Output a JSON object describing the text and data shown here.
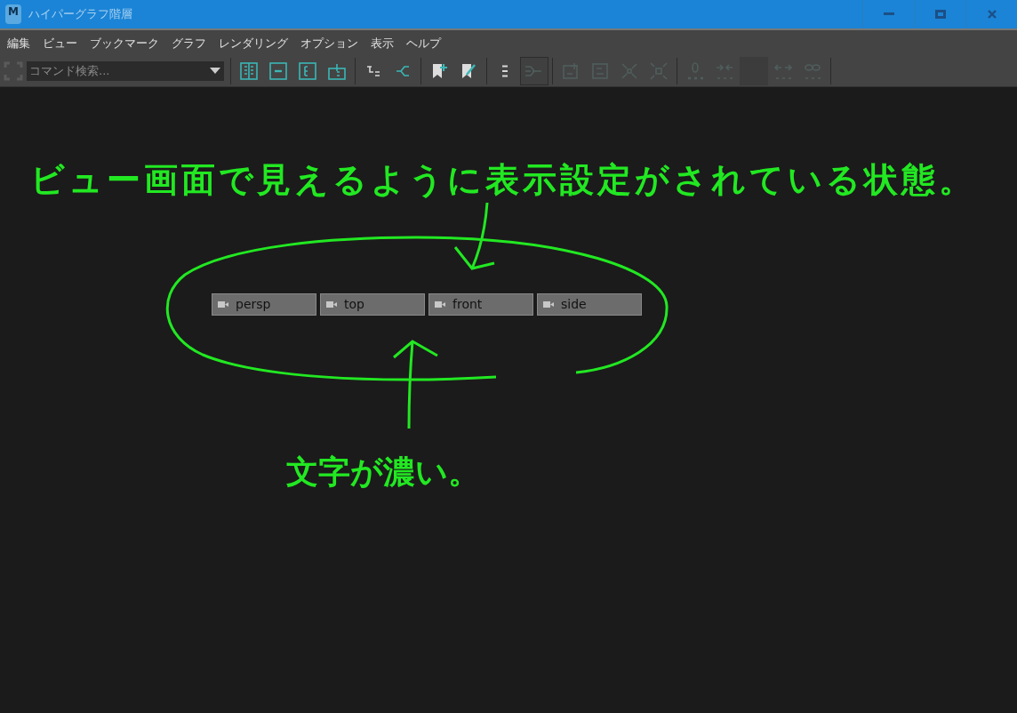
{
  "window": {
    "logo": "M",
    "title": "ハイパーグラフ階層"
  },
  "menu": [
    "編集",
    "ビュー",
    "ブックマーク",
    "グラフ",
    "レンダリング",
    "オプション",
    "表示",
    "ヘルプ"
  ],
  "command_search": {
    "placeholder": "コマンド検索..."
  },
  "toolbar": [
    {
      "kind": "layout",
      "disabled": false,
      "selected": false
    },
    {
      "kind": "minus",
      "disabled": false,
      "selected": false
    },
    {
      "kind": "column",
      "disabled": false,
      "selected": false
    },
    {
      "kind": "split",
      "disabled": false,
      "selected": false
    },
    {
      "kind": "separator"
    },
    {
      "kind": "tree",
      "disabled": false,
      "selected": false
    },
    {
      "kind": "branch",
      "disabled": false,
      "selected": false
    },
    {
      "kind": "separator"
    },
    {
      "kind": "bookmark-add",
      "disabled": false,
      "selected": false
    },
    {
      "kind": "bookmark-edit",
      "disabled": false,
      "selected": false
    },
    {
      "kind": "separator"
    },
    {
      "kind": "list",
      "disabled": false,
      "selected": false
    },
    {
      "kind": "flow",
      "disabled": true,
      "selected": true
    },
    {
      "kind": "separator"
    },
    {
      "kind": "frame-add",
      "disabled": true,
      "selected": false
    },
    {
      "kind": "frame",
      "disabled": true,
      "selected": false
    },
    {
      "kind": "expand",
      "disabled": true,
      "selected": false
    },
    {
      "kind": "collapse",
      "disabled": true,
      "selected": false
    },
    {
      "kind": "separator"
    },
    {
      "kind": "zero",
      "disabled": true,
      "selected": false
    },
    {
      "kind": "merge",
      "disabled": true,
      "selected": false
    },
    {
      "kind": "blank",
      "disabled": true,
      "selected": false
    },
    {
      "kind": "spread",
      "disabled": true,
      "selected": false
    },
    {
      "kind": "link",
      "disabled": true,
      "selected": false
    },
    {
      "kind": "separator"
    }
  ],
  "nodes": [
    {
      "label": "persp"
    },
    {
      "label": "top"
    },
    {
      "label": "front"
    },
    {
      "label": "side"
    }
  ],
  "annotations": [
    {
      "text": "ビュー画面で見えるように表示設定がされている状態。"
    },
    {
      "text": "文字が濃い。"
    }
  ]
}
